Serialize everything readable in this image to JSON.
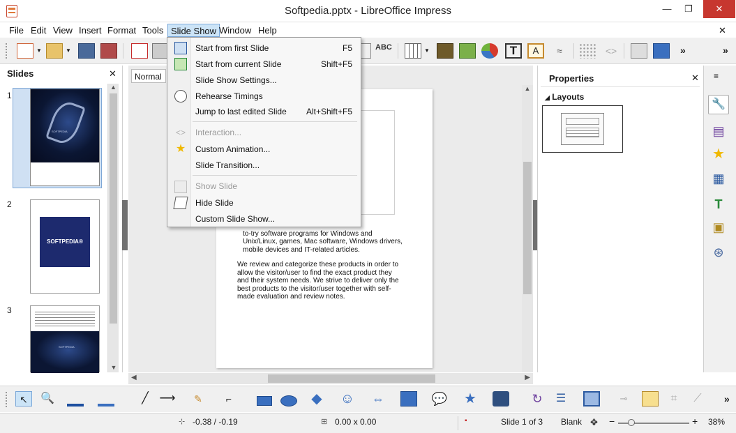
{
  "window": {
    "title": "Softpedia.pptx - LibreOffice Impress",
    "minimize": "—",
    "restore": "❐",
    "close": "✕",
    "doc_close": "✕"
  },
  "menubar": {
    "items": [
      "File",
      "Edit",
      "View",
      "Insert",
      "Format",
      "Tools",
      "Slide Show",
      "Window",
      "Help"
    ],
    "active": "Slide Show"
  },
  "dropdown": {
    "items": [
      {
        "label": "Start from first Slide",
        "shortcut": "F5",
        "enabled": true
      },
      {
        "label": "Start from current Slide",
        "shortcut": "Shift+F5",
        "enabled": true
      },
      {
        "label": "Slide Show Settings...",
        "shortcut": "",
        "enabled": true
      },
      {
        "label": "Rehearse Timings",
        "shortcut": "",
        "enabled": true
      },
      {
        "label": "Jump to last edited Slide",
        "shortcut": "Alt+Shift+F5",
        "enabled": true
      },
      {
        "label": "Interaction...",
        "shortcut": "",
        "enabled": false
      },
      {
        "label": "Custom Animation...",
        "shortcut": "",
        "enabled": true
      },
      {
        "label": "Slide Transition...",
        "shortcut": "",
        "enabled": true
      },
      {
        "label": "Show Slide",
        "shortcut": "",
        "enabled": false
      },
      {
        "label": "Hide Slide",
        "shortcut": "",
        "enabled": true
      },
      {
        "label": "Custom Slide Show...",
        "shortcut": "",
        "enabled": true
      }
    ]
  },
  "slides_pane": {
    "title": "Slides",
    "close": "✕",
    "thumbnails": [
      {
        "number": "1",
        "label": "SOFTPEDIA"
      },
      {
        "number": "2",
        "label": "SOFTPEDIA®"
      },
      {
        "number": "3",
        "label": "SOFTPEDIA"
      }
    ]
  },
  "editor": {
    "tab_normal": "Normal",
    "paragraph1": "Softpedia is a library of over 1,300,000 free and free-to-try software programs for Windows and Unix/Linux, games, Mac software, Windows drivers, mobile devices and IT-related articles.",
    "paragraph1_visible": "ree and free-\nto-try software programs for Windows and\nUnix/Linux, games, Mac software, Windows drivers,\nmobile devices and IT-related articles.",
    "paragraph2": "We review and categorize these products in order to\nallow the visitor/user to find the exact product they\nand their system needs. We strive to deliver only the\nbest products to the visitor/user together with self-\nmade evaluation and review notes."
  },
  "properties": {
    "title": "Properties",
    "close": "✕",
    "section": "Layouts",
    "menu_icon": "≡"
  },
  "status": {
    "position": "-0.38 / -0.19",
    "size": "0.00 x 0.00",
    "slide": "Slide 1 of 3",
    "layout": "Blank",
    "zoom": "38%",
    "zoom_fraction": 0.38
  },
  "colors": {
    "menu_highlight": "#cce4f7",
    "thumb_selected": "#cfe0f3",
    "softpedia_blue": "#1d2a6e",
    "slide1_dark": "#0b1633"
  },
  "icons": {
    "toolbar": [
      "new-icon",
      "open-icon",
      "save-icon",
      "export-pdf-icon",
      "print-icon",
      "spellcheck-icon",
      "table-icon",
      "image-icon",
      "chart-icon",
      "fontwork-icon",
      "textbox-icon",
      "special-char-icon",
      "grid-icon",
      "show-draw-icon",
      "slide-icon"
    ],
    "sidebar": [
      "properties-icon",
      "slide-transition-icon",
      "animation-icon",
      "master-slides-icon",
      "styles-icon",
      "gallery-icon",
      "navigator-icon"
    ]
  }
}
